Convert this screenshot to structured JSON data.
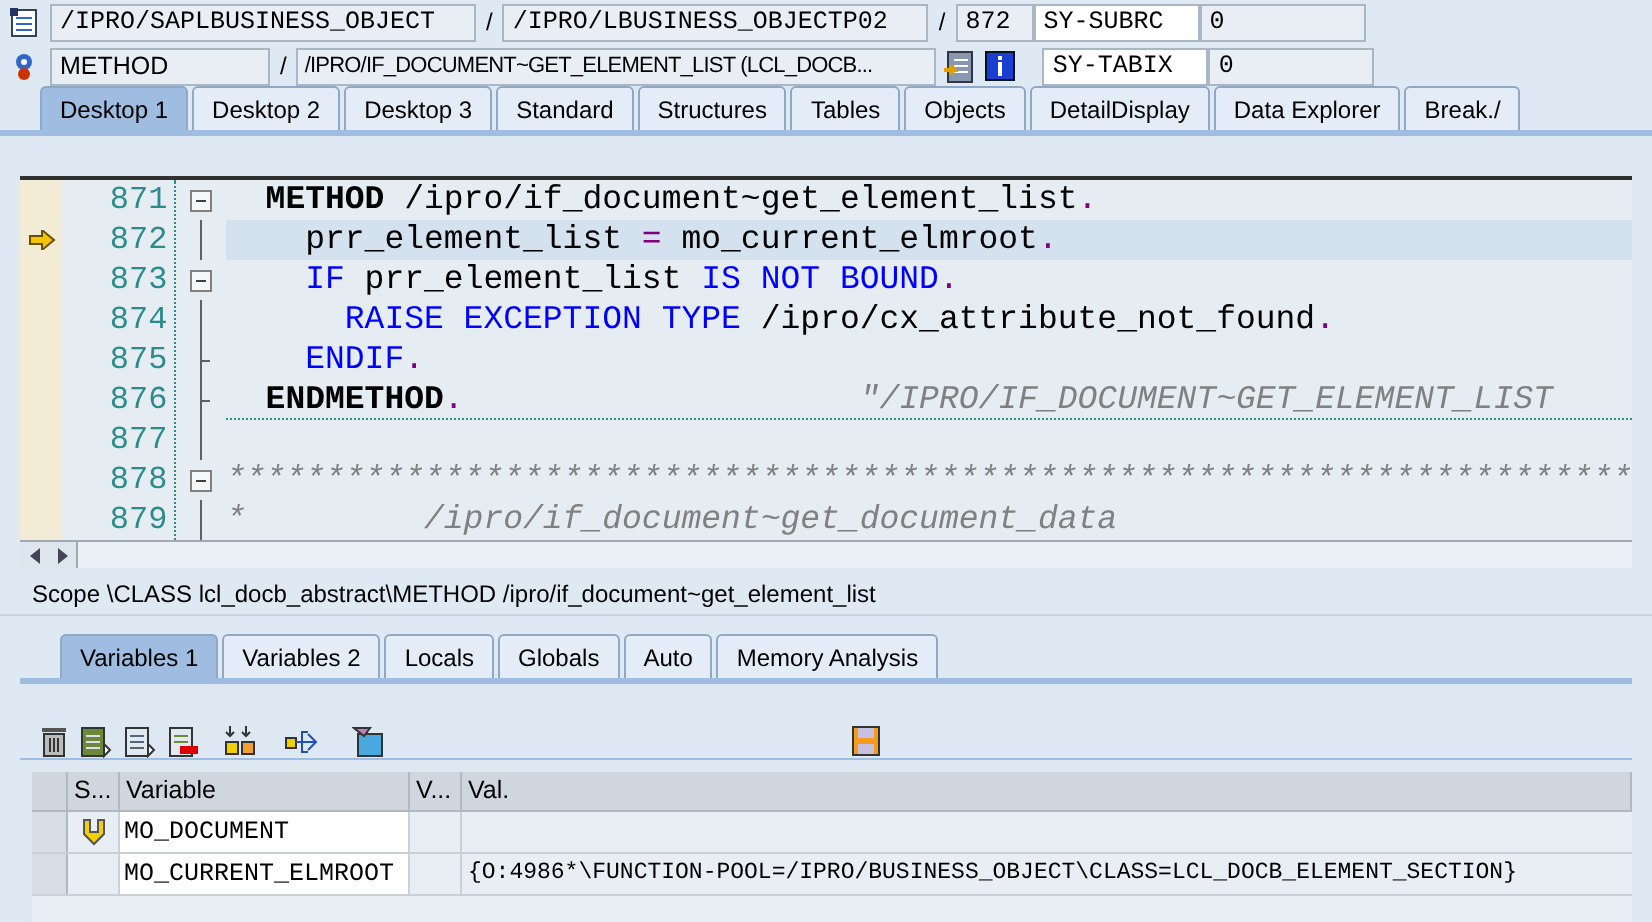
{
  "header": {
    "program": "/IPRO/SAPLBUSINESS_OBJECT",
    "include": "/IPRO/LBUSINESS_OBJECTP02",
    "line": "872",
    "event_type": "METHOD",
    "event": "/IPRO/IF_DOCUMENT~GET_ELEMENT_LIST (LCL_DOCB...",
    "sy_fields": [
      {
        "name": "SY-SUBRC",
        "value": "0"
      },
      {
        "name": "SY-TABIX",
        "value": "0"
      }
    ],
    "separators": [
      "/",
      "/",
      "/"
    ]
  },
  "desktop_tabs": [
    {
      "label": "Desktop 1",
      "selected": true
    },
    {
      "label": "Desktop 2",
      "selected": false
    },
    {
      "label": "Desktop 3",
      "selected": false
    },
    {
      "label": "Standard",
      "selected": false
    },
    {
      "label": "Structures",
      "selected": false
    },
    {
      "label": "Tables",
      "selected": false
    },
    {
      "label": "Objects",
      "selected": false
    },
    {
      "label": "DetailDisplay",
      "selected": false
    },
    {
      "label": "Data Explorer",
      "selected": false
    },
    {
      "label": "Break./",
      "selected": false
    }
  ],
  "editor": {
    "lines": [
      {
        "number": "871",
        "collapsible": true,
        "block_end": false,
        "current": false,
        "separator": false,
        "tokens": [
          {
            "kind": "bold",
            "text": "  METHOD"
          },
          {
            "kind": "text",
            "text": " /ipro/if_document~get_element_list"
          },
          {
            "kind": "punct",
            "text": "."
          }
        ]
      },
      {
        "number": "872",
        "collapsible": false,
        "block_end": false,
        "current": true,
        "separator": false,
        "tokens": [
          {
            "kind": "text",
            "text": "    prr_element_list "
          },
          {
            "kind": "punct",
            "text": "="
          },
          {
            "kind": "text",
            "text": " mo_current_elmroot"
          },
          {
            "kind": "punct",
            "text": "."
          }
        ]
      },
      {
        "number": "873",
        "collapsible": true,
        "block_end": false,
        "current": false,
        "separator": false,
        "tokens": [
          {
            "kind": "keyword",
            "text": "    IF"
          },
          {
            "kind": "text",
            "text": " prr_element_list "
          },
          {
            "kind": "keyword",
            "text": "IS NOT BOUND"
          },
          {
            "kind": "punct",
            "text": "."
          }
        ]
      },
      {
        "number": "874",
        "collapsible": false,
        "block_end": false,
        "current": false,
        "separator": false,
        "tokens": [
          {
            "kind": "keyword",
            "text": "      RAISE EXCEPTION TYPE"
          },
          {
            "kind": "text",
            "text": " /ipro/cx_attribute_not_found"
          },
          {
            "kind": "punct",
            "text": "."
          }
        ]
      },
      {
        "number": "875",
        "collapsible": false,
        "block_end": true,
        "current": false,
        "separator": false,
        "tokens": [
          {
            "kind": "keyword",
            "text": "    ENDIF"
          },
          {
            "kind": "punct",
            "text": "."
          }
        ]
      },
      {
        "number": "876",
        "collapsible": false,
        "block_end": true,
        "current": false,
        "separator": true,
        "tokens": [
          {
            "kind": "bold",
            "text": "  ENDMETHOD"
          },
          {
            "kind": "punct",
            "text": "."
          },
          {
            "kind": "comment",
            "text": "                    \"/IPRO/IF_DOCUMENT~GET_ELEMENT_LIST"
          }
        ]
      },
      {
        "number": "877",
        "collapsible": false,
        "block_end": false,
        "current": false,
        "separator": false
      },
      {
        "number": "878",
        "collapsible": true,
        "block_end": false,
        "current": false,
        "separator": false,
        "tokens": [
          {
            "kind": "comment",
            "text": "***********************************************************************"
          }
        ]
      },
      {
        "number": "879",
        "collapsible": false,
        "block_end": false,
        "current": false,
        "separator": false,
        "tokens": [
          {
            "kind": "comment",
            "text": "*         /ipro/if_document~get_document_data"
          }
        ]
      }
    ]
  },
  "scope": "Scope \\CLASS lcl_docb_abstract\\METHOD /ipro/if_document~get_element_list",
  "variable_tabs": [
    {
      "label": "Variables 1",
      "selected": true
    },
    {
      "label": "Variables 2",
      "selected": false
    },
    {
      "label": "Locals",
      "selected": false
    },
    {
      "label": "Globals",
      "selected": false
    },
    {
      "label": "Auto",
      "selected": false
    },
    {
      "label": "Memory Analysis",
      "selected": false
    }
  ],
  "variables": {
    "columns": [
      "S...",
      "Variable",
      "V...",
      "Val."
    ],
    "rows": [
      {
        "changed": true,
        "variable": "MO_DOCUMENT"
      },
      {
        "changed": false,
        "variable": "MO_CURRENT_ELMROOT",
        "value": "{O:4986*\\FUNCTION-POOL=/IPRO/BUSINESS_OBJECT\\CLASS=LCL_DOCB_ELEMENT_SECTION}"
      }
    ]
  }
}
